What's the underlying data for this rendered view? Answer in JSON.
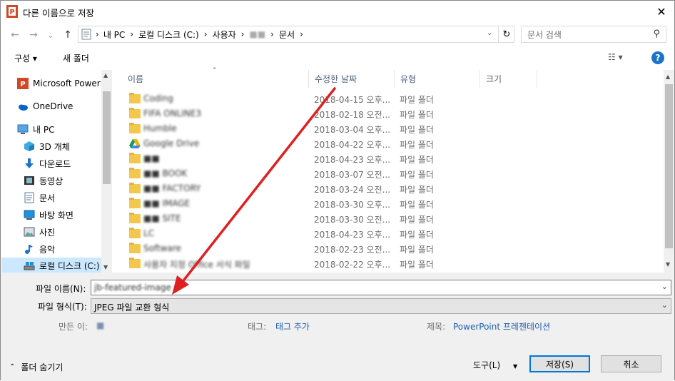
{
  "window": {
    "title": "다른 이름으로 저장",
    "close": "✕"
  },
  "nav": {
    "back": "←",
    "forward": "→",
    "recent": "⌄",
    "up": "↑"
  },
  "address": {
    "crumbs": [
      "내 PC",
      "로컬 디스크 (C:)",
      "사용자",
      "■■",
      "문서"
    ],
    "separator": "›",
    "refresh": "↻"
  },
  "search": {
    "placeholder": "문서 검색"
  },
  "toolbar": {
    "organize": "구성 ▾",
    "new_folder": "새 폴더",
    "view": "☷ ▾",
    "help": "?"
  },
  "sidebar": {
    "items": [
      {
        "label": "Microsoft PowerP",
        "icon": "powerpoint-icon"
      },
      {
        "label": "OneDrive",
        "icon": "onedrive-icon"
      },
      {
        "label": "내 PC",
        "icon": "pc-icon"
      },
      {
        "label": "3D 개체",
        "icon": "3d-objects-icon"
      },
      {
        "label": "다운로드",
        "icon": "download-icon"
      },
      {
        "label": "동영상",
        "icon": "video-icon"
      },
      {
        "label": "문서",
        "icon": "document-icon"
      },
      {
        "label": "바탕 화면",
        "icon": "desktop-icon"
      },
      {
        "label": "사진",
        "icon": "pictures-icon"
      },
      {
        "label": "음악",
        "icon": "music-icon"
      },
      {
        "label": "로컬 디스크 (C:)",
        "icon": "drive-icon"
      }
    ]
  },
  "columns": {
    "name": "이름",
    "modified": "수정한 날짜",
    "type": "유형",
    "size": "크기"
  },
  "files": [
    {
      "name": "Coding",
      "modified": "2018-04-15 오후...",
      "type": "파일 폴더",
      "icon": "folder-icon"
    },
    {
      "name": "FIFA ONLINE3",
      "modified": "2018-02-18 오전...",
      "type": "파일 폴더",
      "icon": "folder-icon"
    },
    {
      "name": "Humble",
      "modified": "2018-03-04 오후...",
      "type": "파일 폴더",
      "icon": "folder-icon"
    },
    {
      "name": "Google Drive",
      "modified": "2018-04-22 오후...",
      "type": "파일 폴더",
      "icon": "gdrive-icon"
    },
    {
      "name": "■■",
      "modified": "2018-04-23 오후...",
      "type": "파일 폴더",
      "icon": "folder-icon"
    },
    {
      "name": "■■ BOOK",
      "modified": "2018-03-07 오전...",
      "type": "파일 폴더",
      "icon": "folder-icon"
    },
    {
      "name": "■■ FACTORY",
      "modified": "2018-03-24 오전...",
      "type": "파일 폴더",
      "icon": "folder-icon"
    },
    {
      "name": "■■ IMAGE",
      "modified": "2018-03-30 오후...",
      "type": "파일 폴더",
      "icon": "folder-icon"
    },
    {
      "name": "■■ SITE",
      "modified": "2018-03-30 오전...",
      "type": "파일 폴더",
      "icon": "folder-icon"
    },
    {
      "name": "LC",
      "modified": "2018-04-23 오후...",
      "type": "파일 폴더",
      "icon": "folder-icon"
    },
    {
      "name": "Software",
      "modified": "2018-02-23 오전...",
      "type": "파일 폴더",
      "icon": "folder-icon"
    },
    {
      "name": "사용자 지정 Office 서식 파일",
      "modified": "2018-02-22 오후...",
      "type": "파일 폴더",
      "icon": "folder-icon"
    }
  ],
  "form": {
    "filename_label": "파일 이름(N):",
    "filename_value": "jb-featured-image",
    "filetype_label": "파일 형식(T):",
    "filetype_value": "JPEG 파일 교환 형식",
    "author_label": "만든 이:",
    "author_value": "■",
    "tags_label": "태그:",
    "tags_value": "태그 추가",
    "title_label": "제목:",
    "title_value": "PowerPoint 프레젠테이션"
  },
  "footer": {
    "hide_folders": "폴더 숨기기",
    "tools": "도구(L)",
    "tools_dd": "▼",
    "save": "저장(S)",
    "cancel": "취소"
  },
  "colors": {
    "accent": "#0066cc",
    "selection": "#cce8ff",
    "arrow": "#e02020"
  }
}
